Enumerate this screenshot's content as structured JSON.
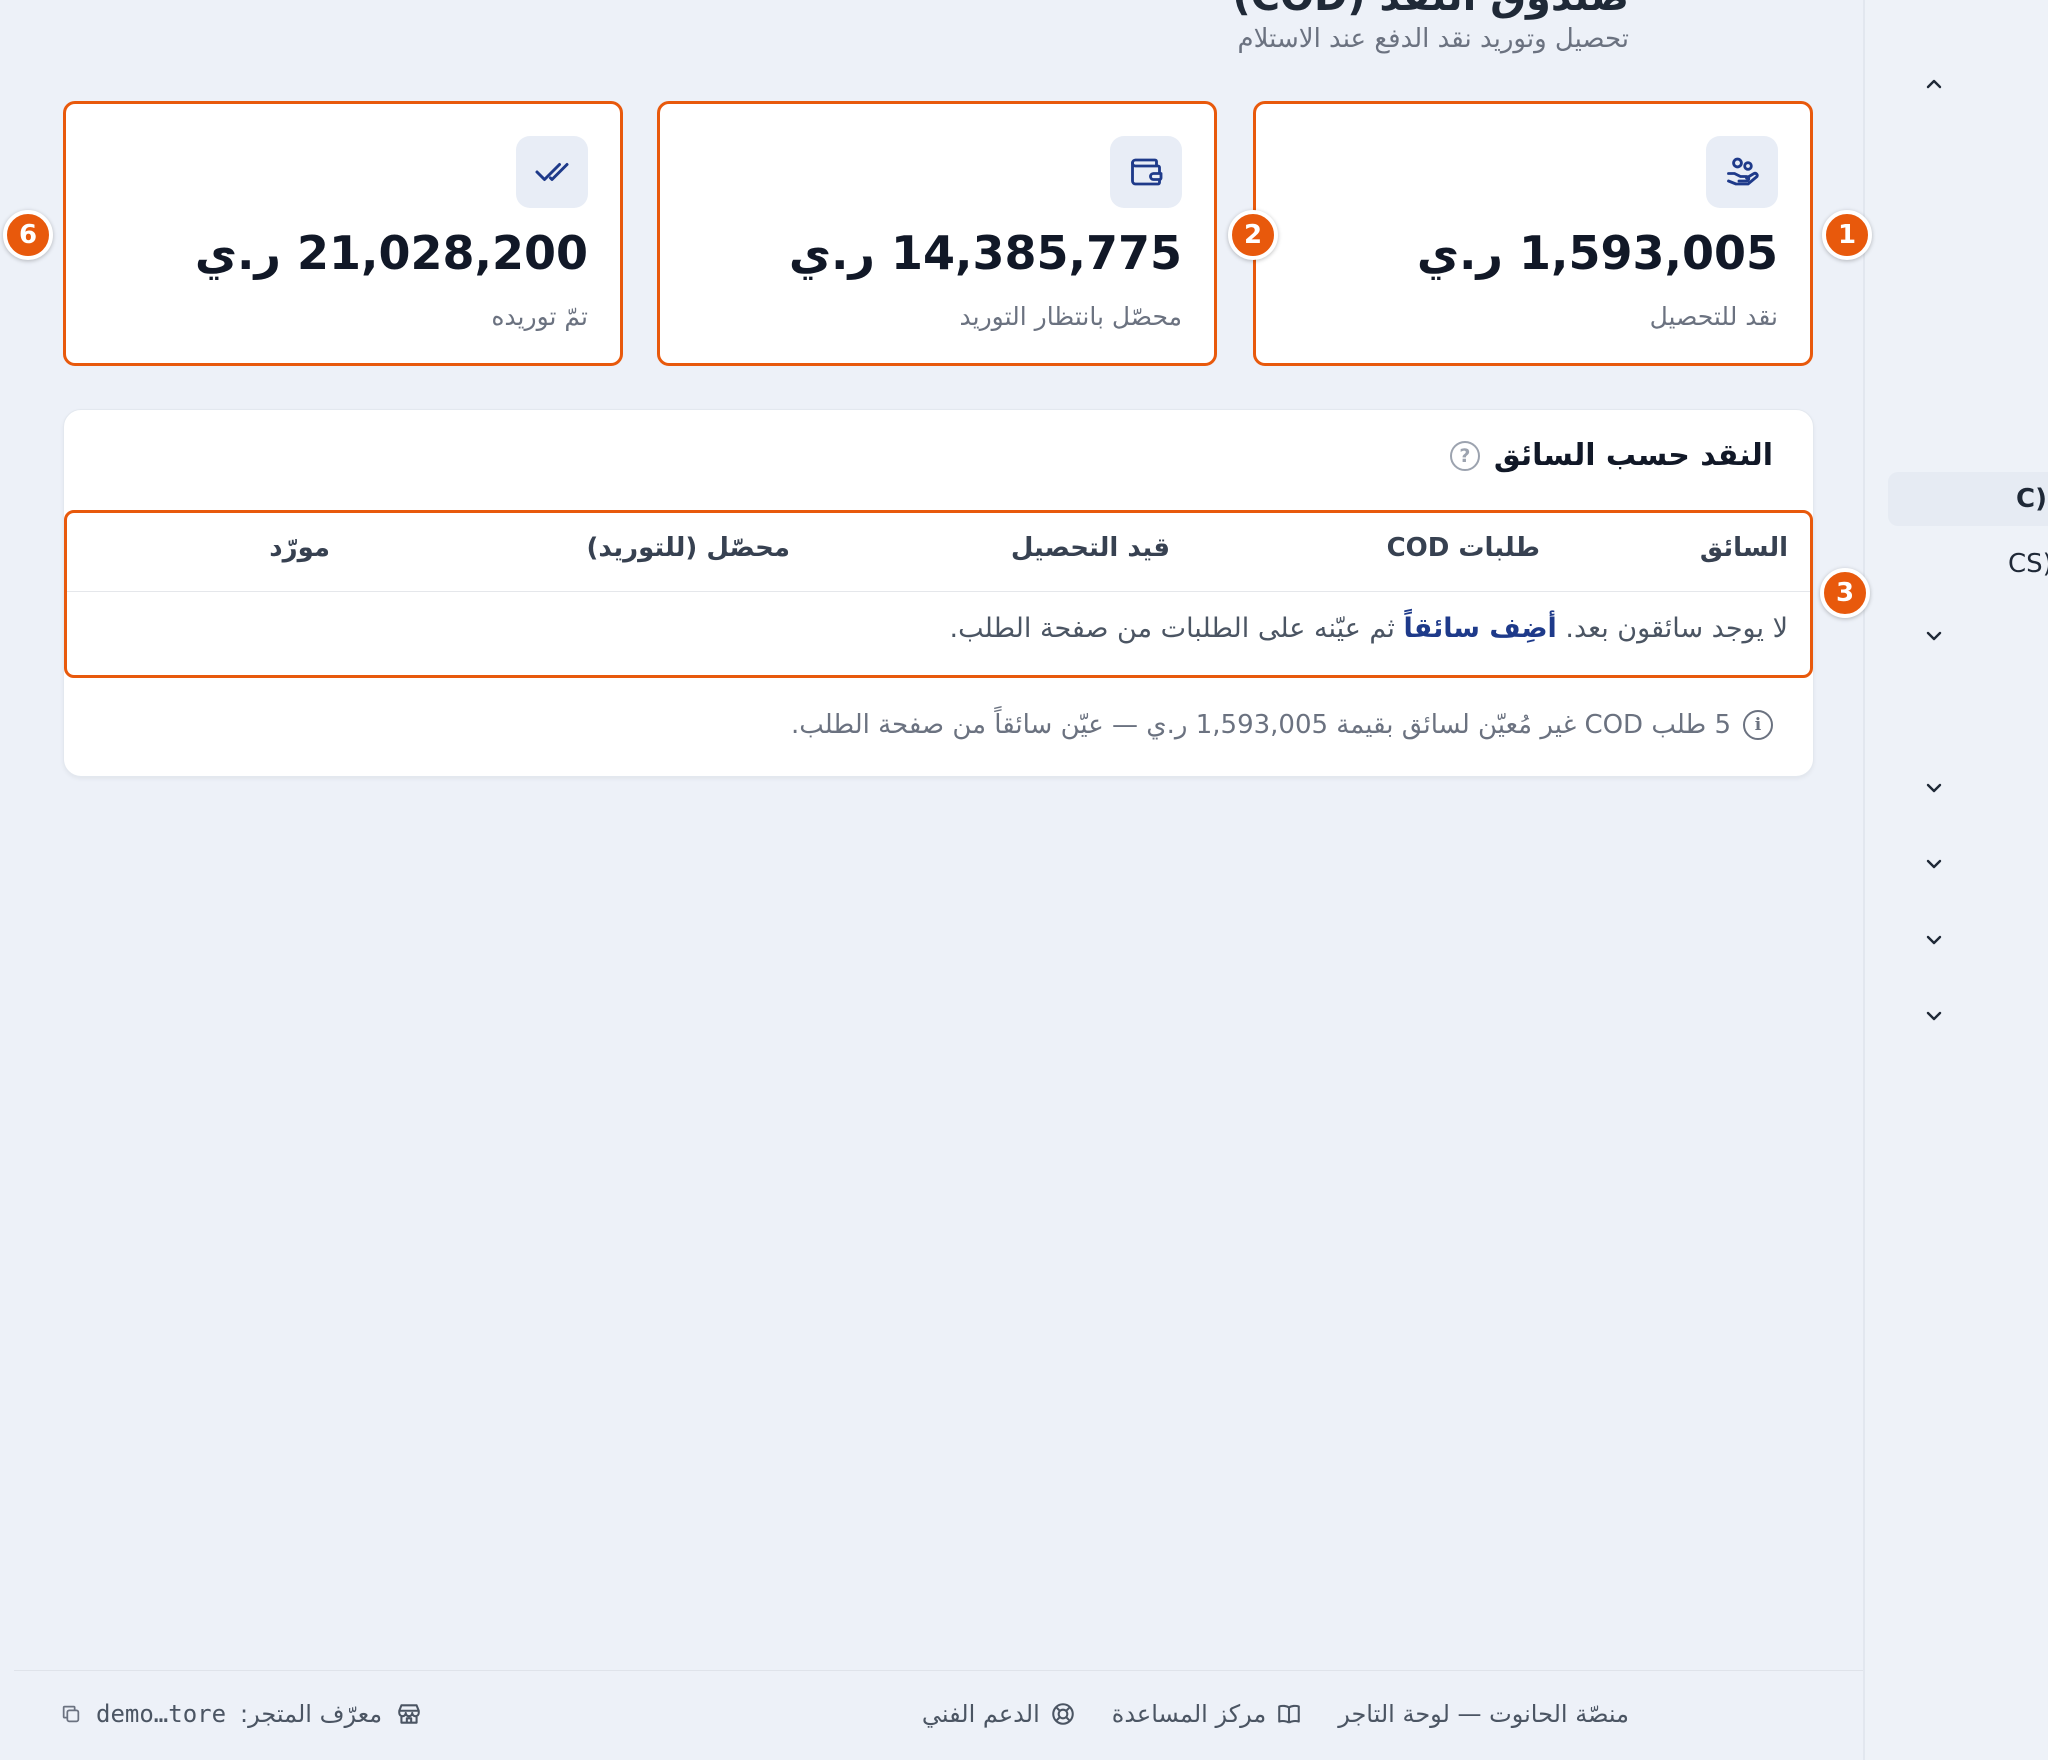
{
  "page": {
    "title": "صندوق النقد (COD)",
    "subtitle": "تحصيل وتوريد نقد الدفع عند الاستلام"
  },
  "cards": [
    {
      "amount": "1,593,005 ر.ي",
      "label": "نقد للتحصيل",
      "icon": "hand-coins-icon",
      "badge": "1"
    },
    {
      "amount": "14,385,775 ر.ي",
      "label": "محصّل بانتظار التوريد",
      "icon": "wallet-icon",
      "badge": "2"
    },
    {
      "amount": "21,028,200 ر.ي",
      "label": "تمّ توريده",
      "icon": "double-check-icon",
      "badge": "6"
    }
  ],
  "driver_panel": {
    "title": "النقد حسب السائق",
    "badge": "3",
    "columns": [
      "السائق",
      "طلبات COD",
      "قيد التحصيل",
      "محصّل (للتوريد)",
      "مورّد"
    ],
    "empty_text_before": "لا يوجد سائقون بعد.",
    "empty_link": "أضِف سائقاً",
    "empty_text_after": "ثم عيّنه على الطلبات من صفحة الطلب.",
    "note": "5 طلب COD غير مُعيّن لسائق بقيمة 1,593,005 ر.ي — عيّن سائقاً من صفحة الطلب."
  },
  "sidebar": {
    "items": [
      {
        "label": "(C"
      },
      {
        "label": "(CS"
      }
    ]
  },
  "footer": {
    "platform": "منصّة الحانوت — لوحة التاجر",
    "help_center": "مركز المساعدة",
    "support": "الدعم الفني",
    "store_id_label": "معرّف المتجر:",
    "store_id_value": "demo…tore"
  },
  "colors": {
    "accent": "#e8590c",
    "link": "#1e3a8a",
    "icon": "#1e3a8a"
  }
}
